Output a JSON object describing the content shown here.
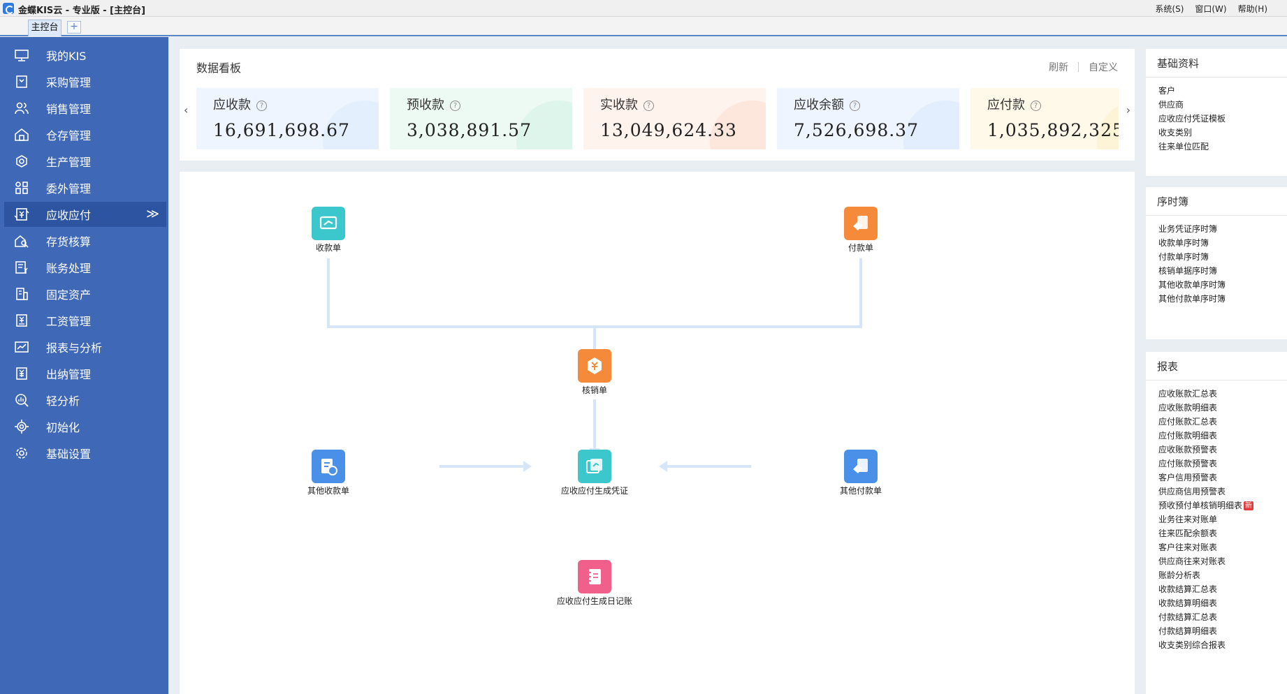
{
  "window": {
    "title": "金蝶KIS云 - 专业版 - [主控台]",
    "menu": [
      "系统(S)",
      "窗口(W)",
      "帮助(H)"
    ]
  },
  "tabs": {
    "main_label": "主控台",
    "add_label": "+"
  },
  "sidebar": {
    "items": [
      {
        "label": "我的KIS",
        "icon": "monitor-icon"
      },
      {
        "label": "采购管理",
        "icon": "cart-icon"
      },
      {
        "label": "销售管理",
        "icon": "people-icon"
      },
      {
        "label": "仓存管理",
        "icon": "warehouse-icon"
      },
      {
        "label": "生产管理",
        "icon": "gear-icon"
      },
      {
        "label": "委外管理",
        "icon": "grid-icon"
      },
      {
        "label": "应收应付",
        "icon": "yen-exchange-icon",
        "active": true
      },
      {
        "label": "存货核算",
        "icon": "inventory-search-icon"
      },
      {
        "label": "账务处理",
        "icon": "ledger-icon"
      },
      {
        "label": "固定资产",
        "icon": "building-icon"
      },
      {
        "label": "工资管理",
        "icon": "salary-icon"
      },
      {
        "label": "报表与分析",
        "icon": "line-chart-icon"
      },
      {
        "label": "出纳管理",
        "icon": "cashier-icon"
      },
      {
        "label": "轻分析",
        "icon": "magnifier-chart-icon"
      },
      {
        "label": "初始化",
        "icon": "target-icon"
      },
      {
        "label": "基础设置",
        "icon": "settings-icon"
      }
    ],
    "active_arrow": "≫"
  },
  "dashboard": {
    "title": "数据看板",
    "refresh_label": "刷新",
    "customize_label": "自定义",
    "prev_arrow": "‹",
    "next_arrow": "›",
    "help_glyph": "?",
    "cards": [
      {
        "label": "应收款",
        "value": "16,691,698.67",
        "bg": "#eef5fe",
        "accent": "#dbe9fc"
      },
      {
        "label": "预收款",
        "value": "3,038,891.57",
        "bg": "#ecfaf3",
        "accent": "#d2f1e2"
      },
      {
        "label": "实收款",
        "value": "13,049,624.33",
        "bg": "#fff3ee",
        "accent": "#fcdccf"
      },
      {
        "label": "应收余额",
        "value": "7,526,698.37",
        "bg": "#eef5fe",
        "accent": "#d8e7fb"
      },
      {
        "label": "应付款",
        "value": "1,035,892,325",
        "bg": "#fff9e9",
        "accent": "#fbeec8"
      }
    ]
  },
  "flow": {
    "nodes": [
      {
        "id": "receipt",
        "label": "收款单",
        "color": "#3cc7cc",
        "icon": "receipt-icon"
      },
      {
        "id": "payment",
        "label": "付款单",
        "color": "#f58a3a",
        "icon": "payment-icon"
      },
      {
        "id": "writeoff",
        "label": "核销单",
        "color": "#f58a3a",
        "icon": "yen-badge-icon"
      },
      {
        "id": "other-receipt",
        "label": "其他收款单",
        "color": "#4a8fe8",
        "icon": "other-receipt-icon"
      },
      {
        "id": "voucher",
        "label": "应收应付生成凭证",
        "color": "#3cc7cc",
        "icon": "voucher-icon"
      },
      {
        "id": "other-payment",
        "label": "其他付款单",
        "color": "#4a8fe8",
        "icon": "other-payment-icon"
      },
      {
        "id": "journal",
        "label": "应收应付生成日记账",
        "color": "#f0608a",
        "icon": "journal-icon"
      }
    ],
    "line_color": "#d6e6f7"
  },
  "panels": {
    "basic": {
      "title": "基础资料",
      "items": [
        "客户",
        "供应商",
        "应收应付凭证模板",
        "收支类别",
        "往来单位匹配"
      ]
    },
    "sequence": {
      "title": "序时簿",
      "items": [
        "业务凭证序时簿",
        "收款单序时簿",
        "付款单序时簿",
        "核销单据序时簿",
        "其他收款单序时簿",
        "其他付款单序时簿"
      ]
    },
    "reports": {
      "title": "报表",
      "new_badge": "新",
      "items": [
        "应收账款汇总表",
        "应收账款明细表",
        "应付账款汇总表",
        "应付账款明细表",
        "应收账款预警表",
        "应付账款预警表",
        "客户信用预警表",
        "供应商信用预警表",
        "预收预付单核销明细表",
        "业务往来对账单",
        "往来匹配余额表",
        "客户往来对账表",
        "供应商往来对账表",
        "账龄分析表",
        "收款结算汇总表",
        "收款结算明细表",
        "付款结算汇总表",
        "付款结算明细表",
        "收支类别综合报表"
      ],
      "new_item_index": 8
    }
  }
}
